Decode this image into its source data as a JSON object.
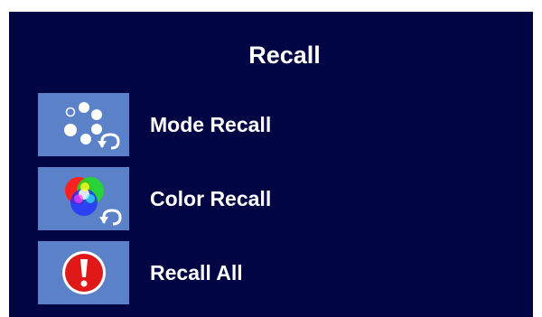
{
  "menu": {
    "title": "Recall",
    "items": [
      {
        "label": "Mode Recall",
        "icon": "mode-recall-icon"
      },
      {
        "label": "Color Recall",
        "icon": "color-recall-icon"
      },
      {
        "label": "Recall All",
        "icon": "recall-all-icon"
      }
    ]
  },
  "colors": {
    "panel_background": "#020544",
    "icon_tile": "#5b81c8",
    "text": "#ffffff",
    "alert_red": "#e01818"
  }
}
